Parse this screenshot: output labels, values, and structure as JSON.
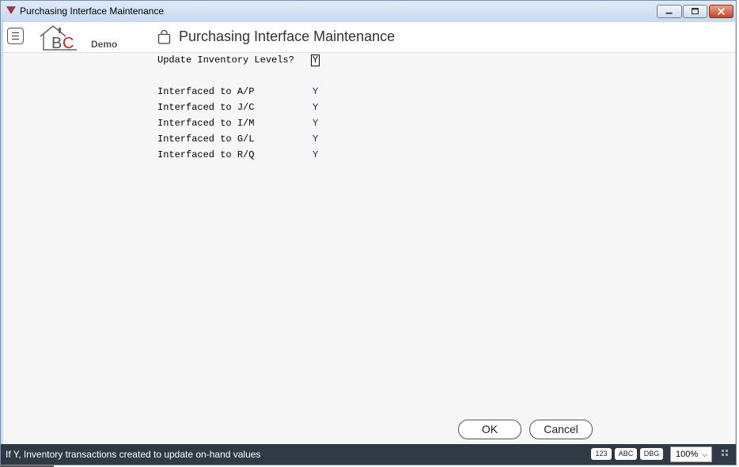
{
  "window": {
    "title": "Purchasing Interface Maintenance",
    "minimize_icon": "minimize-icon",
    "maximize_icon": "maximize-icon",
    "close_icon": "close-icon"
  },
  "header": {
    "menu_icon": "hamburger-menu-icon",
    "logo_text": "BC",
    "logo_subtitle": "Demo",
    "page_icon": "shopping-bag-icon",
    "page_title": "Purchasing Interface Maintenance"
  },
  "form": {
    "update_inventory_label": "Update Inventory Levels?",
    "update_inventory_value": "Y",
    "interfaces": [
      {
        "label": "Interfaced to A/P",
        "value": "Y"
      },
      {
        "label": "Interfaced to J/C",
        "value": "Y"
      },
      {
        "label": "Interfaced to I/M",
        "value": "Y"
      },
      {
        "label": "Interfaced to G/L",
        "value": "Y"
      },
      {
        "label": "Interfaced to R/Q",
        "value": "Y"
      }
    ]
  },
  "buttons": {
    "ok": "OK",
    "cancel": "Cancel"
  },
  "statusbar": {
    "message": "If Y, Inventory transactions created to update on-hand values",
    "chip_123": "123",
    "chip_abc": "ABC",
    "chip_dbg": "DBG",
    "zoom": "100%"
  },
  "colors": {
    "accent_red": "#c0282d",
    "status_bg": "#2f3a44",
    "value_blue": "#1a1a8a"
  }
}
